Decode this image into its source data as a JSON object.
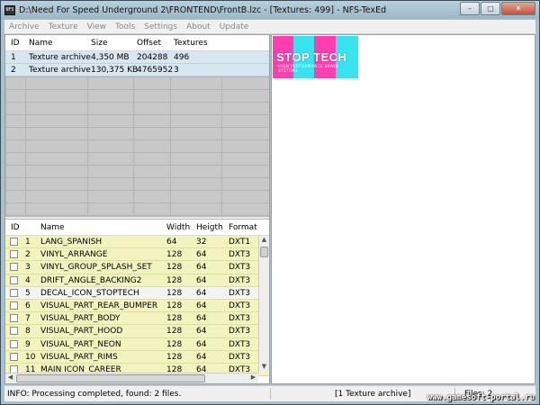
{
  "window": {
    "title": "D:\\Need For Speed Underground 2\\FRONTEND\\FrontB.lzc - [Textures: 499] - NFS-TexEd",
    "app_icon_text": "NFS",
    "min": "–",
    "max": "□",
    "close": "✕"
  },
  "menu": [
    "Archive",
    "Texture",
    "View",
    "Tools",
    "Settings",
    "About",
    "Update"
  ],
  "archives": {
    "columns": [
      "ID",
      "Name",
      "Size",
      "Offset",
      "Textures"
    ],
    "rows": [
      [
        "1",
        "Texture archive",
        "4,350 MB",
        "204288",
        "496"
      ],
      [
        "2",
        "Texture archive",
        "130,375 KB",
        "4765952",
        "3"
      ]
    ]
  },
  "textures": {
    "columns": [
      "ID",
      "Name",
      "Width",
      "Heigth",
      "Format"
    ],
    "rows": [
      [
        "1",
        "LANG_SPANISH",
        "64",
        "32",
        "DXT1"
      ],
      [
        "2",
        "VINYL_ARRANGE",
        "128",
        "64",
        "DXT3"
      ],
      [
        "3",
        "VINYL_GROUP_SPLASH_SET",
        "128",
        "64",
        "DXT3"
      ],
      [
        "4",
        "DRIFT_ANGLE_BACKING2",
        "128",
        "64",
        "DXT3"
      ],
      [
        "5",
        "DECAL_ICON_STOPTECH",
        "128",
        "64",
        "DXT3"
      ],
      [
        "6",
        "VISUAL_PART_REAR_BUMPER",
        "128",
        "64",
        "DXT3"
      ],
      [
        "7",
        "VISUAL_PART_BODY",
        "128",
        "64",
        "DXT3"
      ],
      [
        "8",
        "VISUAL_PART_HOOD",
        "128",
        "64",
        "DXT3"
      ],
      [
        "9",
        "VISUAL_PART_NEON",
        "128",
        "64",
        "DXT3"
      ],
      [
        "10",
        "VISUAL_PART_RIMS",
        "128",
        "64",
        "DXT3"
      ],
      [
        "11",
        "MAIN ICON_CAREER",
        "128",
        "64",
        "DXT3"
      ]
    ],
    "selected_index": 4
  },
  "preview": {
    "logo_text": "STOP TECH",
    "tagline": "HIGH PERFORMANCE BRAKE SYSTEMS"
  },
  "status": {
    "info": "INFO: Processing completed, found: 2 files.",
    "archive": "[1 Texture archive]",
    "files": "Files: 2"
  },
  "watermark": "www.gamesoft-portal.ru",
  "colors": {
    "archive_row": "#d8e6f0",
    "texture_row": "#f3f3bf",
    "preview_magenta": "#ff3fb0",
    "preview_cyan": "#37e3ef"
  }
}
